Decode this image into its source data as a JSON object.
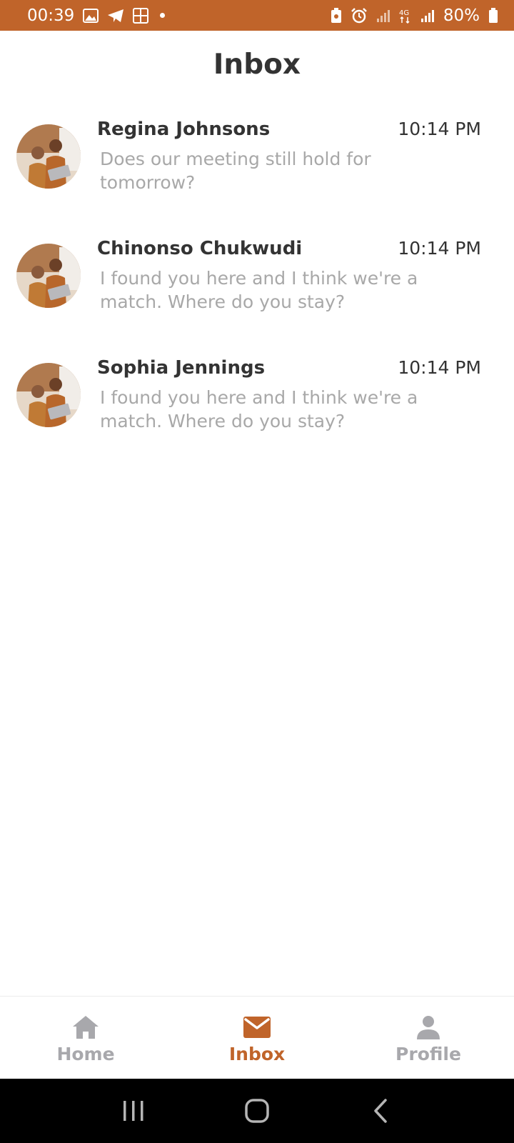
{
  "status_bar": {
    "time": "00:39",
    "battery": "80%",
    "icons": [
      "image-icon",
      "telegram-icon",
      "calculator-icon",
      "dot-icon",
      "battery-saver-icon",
      "alarm-icon",
      "signal-icon",
      "4g-icon",
      "signal-icon",
      "battery-icon"
    ]
  },
  "header": {
    "title": "Inbox"
  },
  "conversations": [
    {
      "name": "Regina Johnsons",
      "time": "10:14 PM",
      "preview": "Does our meeting still hold for tomorrow?"
    },
    {
      "name": "Chinonso Chukwudi",
      "time": "10:14 PM",
      "preview": "I found you here and I think we're a match. Where do you stay?"
    },
    {
      "name": "Sophia Jennings",
      "time": "10:14 PM",
      "preview": "I found you here and I think we're a match. Where do you stay?"
    }
  ],
  "tabs": [
    {
      "label": "Home",
      "icon": "home-icon",
      "active": false
    },
    {
      "label": "Inbox",
      "icon": "mail-icon",
      "active": true
    },
    {
      "label": "Profile",
      "icon": "person-icon",
      "active": false
    }
  ],
  "colors": {
    "accent": "#c0642a",
    "inactive": "#a8a8ac",
    "text": "#333333",
    "muted": "#a8a8a8"
  }
}
